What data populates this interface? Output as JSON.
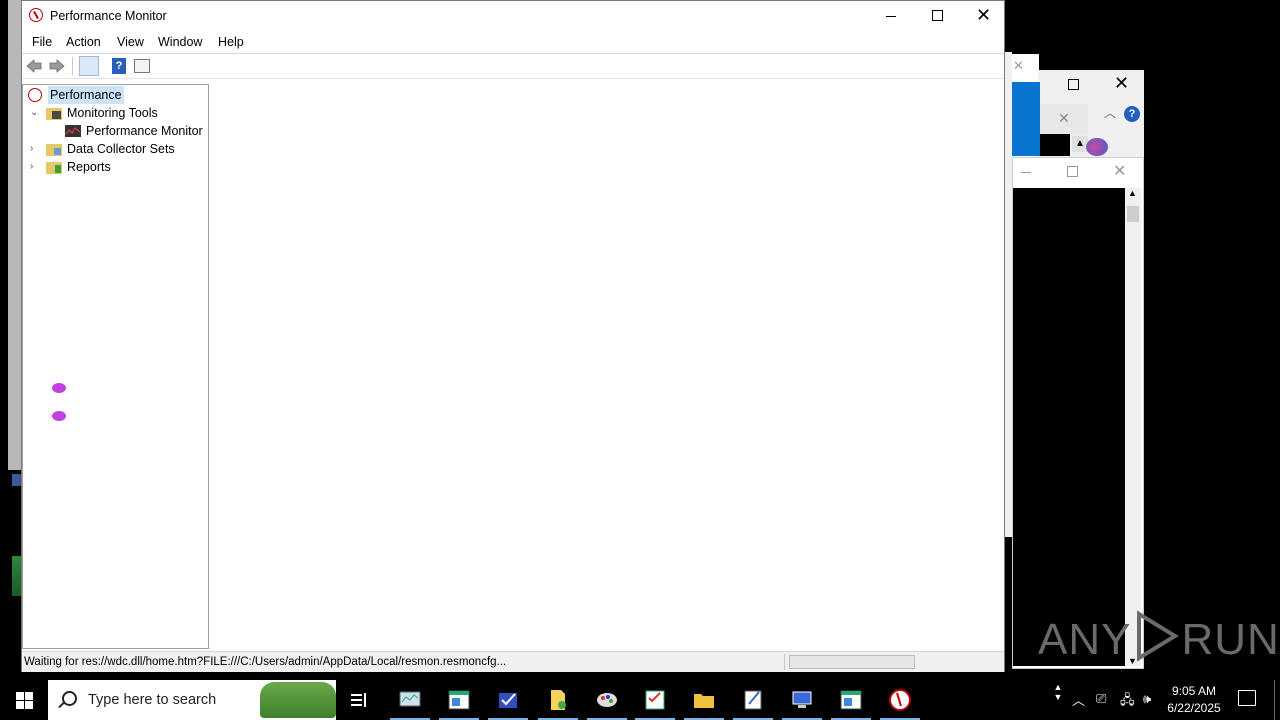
{
  "window": {
    "title": "Performance Monitor"
  },
  "menu": {
    "file": "File",
    "action": "Action",
    "view": "View",
    "window": "Window",
    "help": "Help"
  },
  "tree": {
    "root": "Performance",
    "monitoring_tools": "Monitoring Tools",
    "performance_monitor": "Performance Monitor",
    "data_collector_sets": "Data Collector Sets",
    "reports": "Reports"
  },
  "status": {
    "text": "Waiting for res://wdc.dll/home.htm?FILE:///C:/Users/admin/AppData/Local/resmon.resmoncfg..."
  },
  "taskbar": {
    "search_placeholder": "Type here to search",
    "time": "9:05 AM",
    "date": "6/22/2025"
  },
  "watermark": {
    "left": "ANY",
    "right": "RUN"
  },
  "icons": {
    "title": "performance-gauge-icon",
    "back": "back-arrow-icon",
    "forward": "forward-arrow-icon",
    "console_tree": "console-tree-icon",
    "help": "help-icon",
    "action_pane": "action-pane-icon"
  }
}
